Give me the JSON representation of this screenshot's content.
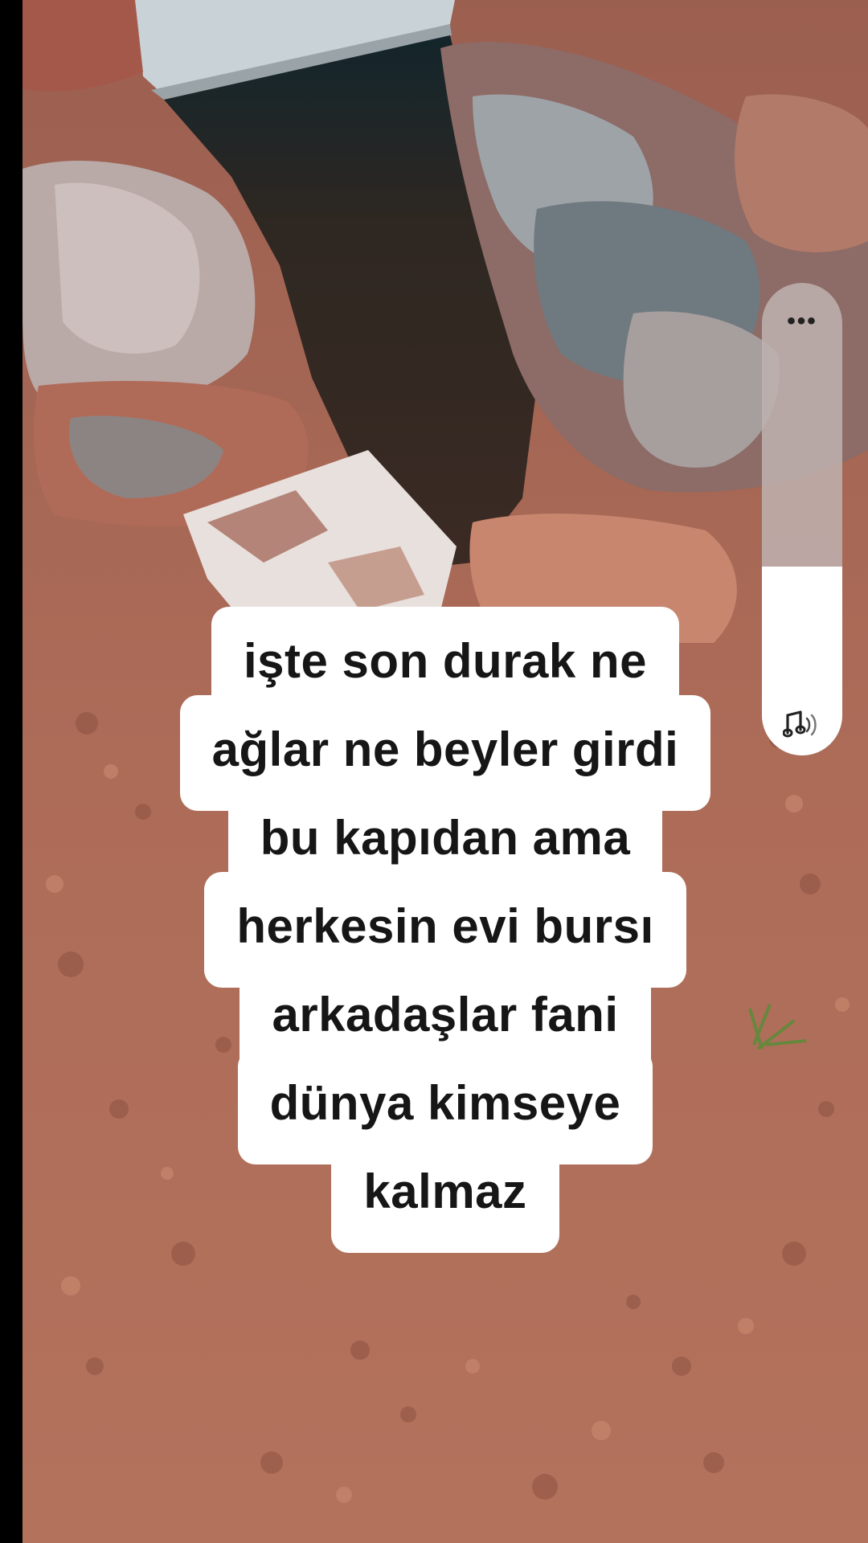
{
  "caption": {
    "lines": [
      "işte son durak ne",
      "ağlar ne beyler girdi",
      "bu kapıdan ama",
      "herkesin evi bursı",
      "arkadaşlar fani",
      "dünya kimseye",
      "kalmaz"
    ]
  },
  "volume": {
    "more_label": "•••",
    "level": 0.4,
    "icon": "speaker-icon"
  },
  "colors": {
    "caption_bg": "#ffffff",
    "caption_text": "#161616",
    "soil": "#a96b58",
    "pit": "#2b211c"
  }
}
